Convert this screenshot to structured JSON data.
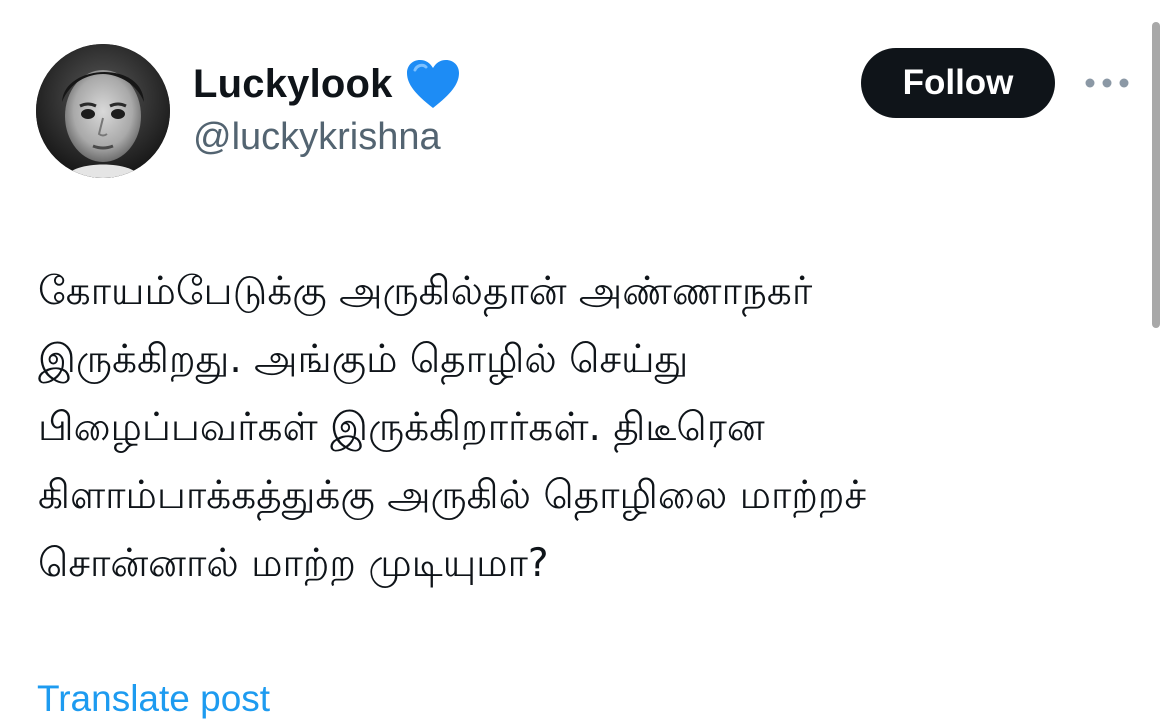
{
  "author": {
    "display_name": "Luckylook",
    "handle": "@luckykrishna",
    "avatar_icon": "avatar-photo",
    "name_emoji_icon": "blue-heart-icon"
  },
  "actions": {
    "follow_label": "Follow",
    "more_icon": "more-horizontal-icon"
  },
  "tweet": {
    "lines": [
      "கோயம்பேடுக்கு அருகில்தான் அண்ணாநகர்",
      "இருக்கிறது. அங்கும் தொழில் செய்து",
      "பிழைப்பவர்கள் இருக்கிறார்கள். திடீரென",
      "கிளாம்பாக்கத்துக்கு அருகில் தொழிலை மாற்றச்",
      "சொன்னால் மாற்ற முடியுமா?"
    ],
    "translate_label": "Translate post"
  },
  "colors": {
    "text": "#0f1419",
    "secondary": "#536471",
    "link": "#1d9bf0",
    "follow_bg": "#0f1419",
    "heart": "#1d8cf5"
  }
}
